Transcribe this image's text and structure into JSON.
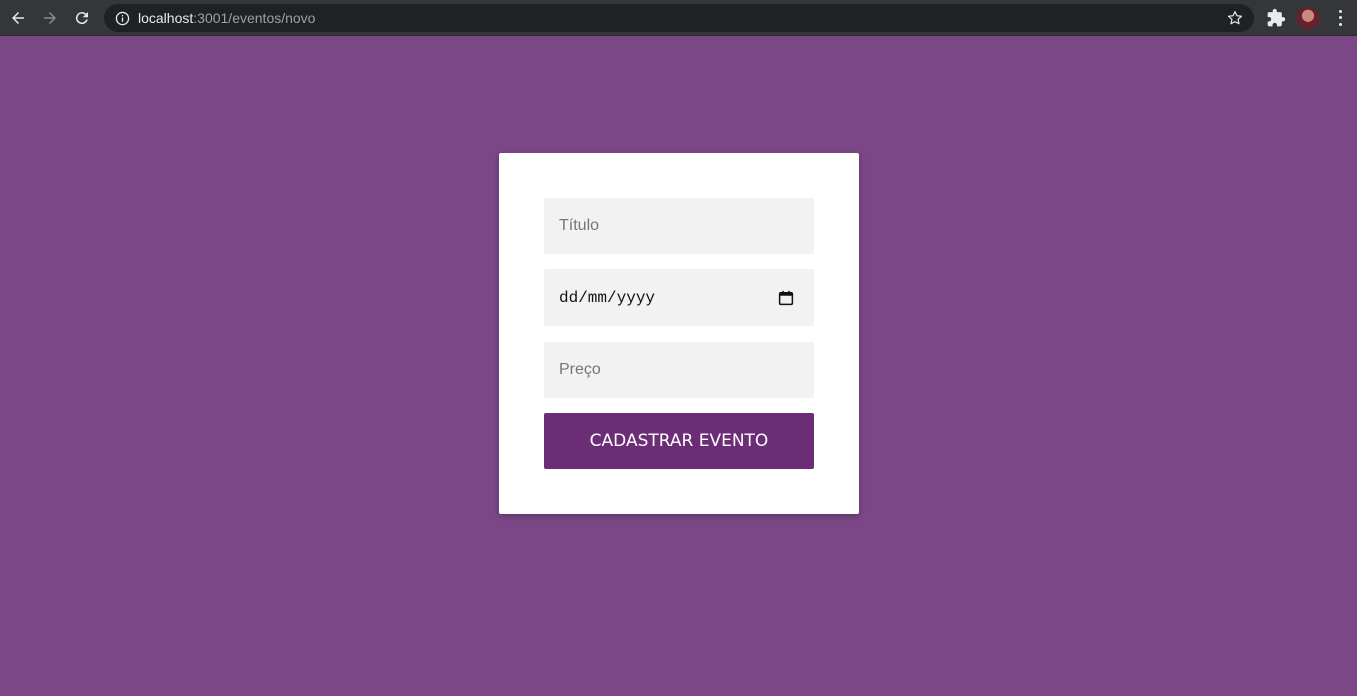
{
  "browser": {
    "url_host": "localhost",
    "url_path": ":3001/eventos/novo",
    "icons": [
      "back-icon",
      "forward-icon",
      "reload-icon",
      "info-icon",
      "star-icon",
      "extensions-icon",
      "avatar",
      "menu-icon"
    ]
  },
  "form": {
    "title_placeholder": "Título",
    "date_placeholder": "dd/mm/yyyy",
    "price_placeholder": "Preço",
    "submit_label": "CADASTRAR EVENTO"
  },
  "colors": {
    "background": "#7b4786",
    "button": "#6b2d75",
    "field": "#f2f2f2"
  }
}
